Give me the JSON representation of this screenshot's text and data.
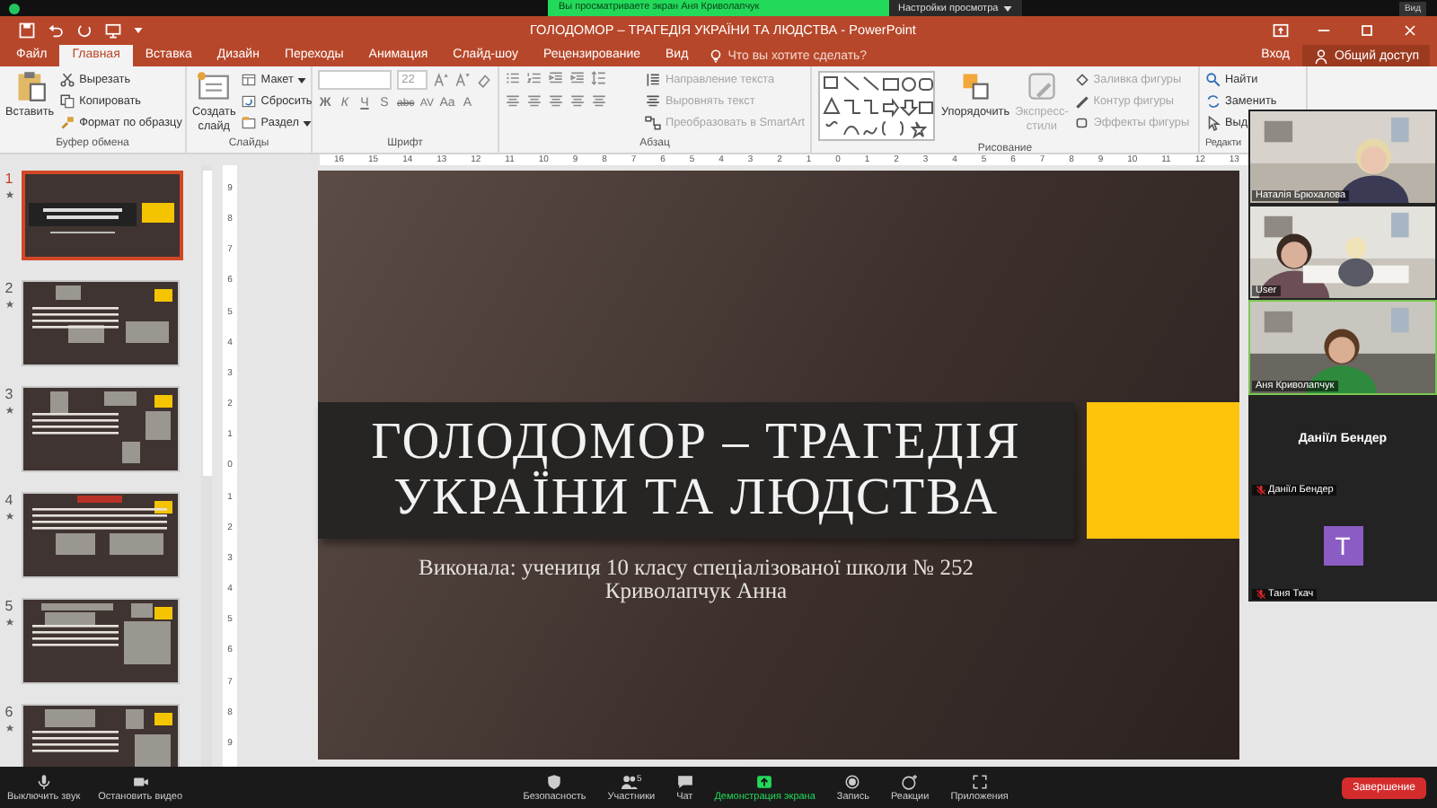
{
  "zoom_bar": {
    "banner": "Вы просматриваете экран Аня Криволапчук",
    "view_options": "Настройки просмотра",
    "view": "Вид"
  },
  "window": {
    "title": "ГОЛОДОМОР – ТРАГЕДІЯ УКРАЇНИ ТА ЛЮДСТВА - PowerPoint"
  },
  "tabs": [
    {
      "label": "Файл",
      "selected": false
    },
    {
      "label": "Главная",
      "selected": true
    },
    {
      "label": "Вставка",
      "selected": false
    },
    {
      "label": "Дизайн",
      "selected": false
    },
    {
      "label": "Переходы",
      "selected": false
    },
    {
      "label": "Анимация",
      "selected": false
    },
    {
      "label": "Слайд-шоу",
      "selected": false
    },
    {
      "label": "Рецензирование",
      "selected": false
    },
    {
      "label": "Вид",
      "selected": false
    }
  ],
  "tell_me": {
    "placeholder": "Что вы хотите сделать?"
  },
  "sign_in": "Вход",
  "share": "Общий доступ",
  "ribbon": {
    "clipboard": {
      "label": "Буфер обмена",
      "paste": "Вставить",
      "items": [
        "Вырезать",
        "Копировать",
        "Формат по образцу"
      ]
    },
    "slides": {
      "label": "Слайды",
      "new_slide": [
        "Создать",
        "слайд"
      ],
      "items": [
        "Макет",
        "Сбросить",
        "Раздел"
      ]
    },
    "font": {
      "label": "Шрифт",
      "size": "22",
      "buttons": [
        "Ж",
        "К",
        "Ч",
        "S",
        "abc",
        "AV",
        "Aa",
        "A"
      ]
    },
    "paragraph": {
      "label": "Абзац",
      "items": [
        {
          "label": "Направление текста",
          "disabled": true
        },
        {
          "label": "Выровнять текст",
          "disabled": true
        },
        {
          "label": "Преобразовать в SmartArt",
          "disabled": true
        }
      ]
    },
    "drawing": {
      "label": "Рисование",
      "arrange": "Упорядочить",
      "quick_styles": [
        "Экспресс-",
        "стили"
      ],
      "items": [
        {
          "label": "Заливка фигуры",
          "disabled": true
        },
        {
          "label": "Контур фигуры",
          "disabled": true
        },
        {
          "label": "Эффекты фигуры",
          "disabled": true
        }
      ]
    },
    "editing": {
      "label": "Редакти",
      "items": [
        "Найти",
        "Заменить",
        "Выд"
      ]
    }
  },
  "ruler": {
    "labels": [
      "16",
      "15",
      "14",
      "13",
      "12",
      "11",
      "10",
      "9",
      "8",
      "7",
      "6",
      "5",
      "4",
      "3",
      "2",
      "1",
      "0",
      "1",
      "2",
      "3",
      "4",
      "5",
      "6",
      "7",
      "8",
      "9",
      "10",
      "11",
      "12",
      "13"
    ]
  },
  "vertical_ruler": {
    "labels": [
      "9",
      "8",
      "7",
      "6",
      "5",
      "4",
      "3",
      "2",
      "1",
      "0",
      "1",
      "2",
      "3",
      "4",
      "5",
      "6",
      "7",
      "8",
      "9"
    ]
  },
  "thumbnails": [
    {
      "number": "1",
      "selected": true
    },
    {
      "number": "2",
      "selected": false
    },
    {
      "number": "3",
      "selected": false
    },
    {
      "number": "4",
      "selected": false
    },
    {
      "number": "5",
      "selected": false
    },
    {
      "number": "6",
      "selected": false
    }
  ],
  "slide": {
    "title_lines": [
      "ГОЛОДОМОР – ТРАГЕДІЯ",
      "УКРАЇНИ ТА ЛЮДСТВА"
    ],
    "subtitle_lines": [
      "Виконала: учениця 10 класу спеціалізованої школи № 252",
      "Криволапчук Анна"
    ]
  },
  "participants": [
    {
      "kind": "video",
      "name": "Наталія Брюхалова",
      "speaking": false,
      "muted": false
    },
    {
      "kind": "video",
      "name": "User",
      "speaking": false,
      "muted": false
    },
    {
      "kind": "video",
      "name": "Аня Криволапчук",
      "speaking": true,
      "muted": false
    },
    {
      "kind": "name",
      "display": "Даніїл Бендер",
      "name": "Даніїл Бендер",
      "speaking": false,
      "muted": true
    },
    {
      "kind": "avatar",
      "initial": "T",
      "name": "Таня Ткач",
      "speaking": false,
      "muted": true
    }
  ],
  "toolbar": {
    "left": [
      {
        "label": "Выключить звук"
      },
      {
        "label": "Остановить видео"
      }
    ],
    "center": [
      {
        "label": "Безопасность",
        "active": false
      },
      {
        "label": "Участники",
        "count": "5",
        "active": false
      },
      {
        "label": "Чат",
        "active": false
      },
      {
        "label": "Демонстрация экрана",
        "active": true
      },
      {
        "label": "Запись",
        "active": false
      },
      {
        "label": "Реакции",
        "active": false
      },
      {
        "label": "Приложения",
        "active": false
      }
    ],
    "end": "Завершение"
  }
}
